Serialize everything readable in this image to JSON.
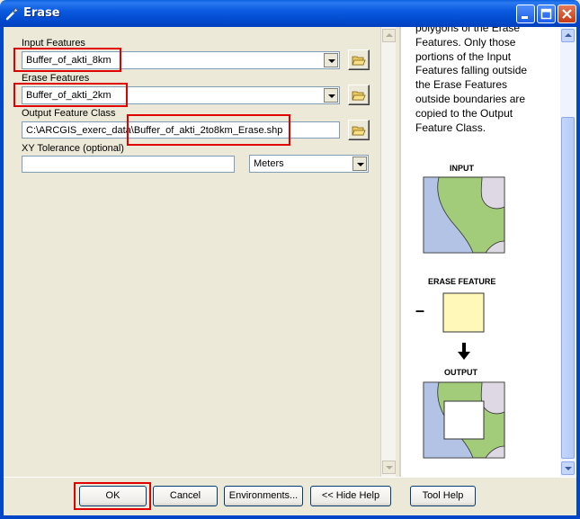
{
  "window": {
    "title": "Erase"
  },
  "form": {
    "input_features": {
      "label": "Input Features",
      "value": "Buffer_of_akti_8km"
    },
    "erase_features": {
      "label": "Erase Features",
      "value": "Buffer_of_akti_2km"
    },
    "output_feature_class": {
      "label": "Output Feature Class",
      "value_prefix": "C:\\ARCGIS_exerc_data",
      "value_suffix": "\\Buffer_of_akti_2to8km_Erase.shp"
    },
    "xy_tolerance": {
      "label": "XY Tolerance (optional)",
      "value": "",
      "units": "Meters"
    }
  },
  "help": {
    "text_lines": [
      "polygons of the Erase",
      "Features. Only those",
      "portions of the Input",
      "Features falling outside",
      "the Erase Features",
      "outside boundaries are",
      "copied to the Output",
      "Feature Class."
    ],
    "diagram": {
      "input_label": "INPUT",
      "erase_label": "ERASE FEATURE",
      "minus_sign": "–",
      "output_label": "OUTPUT"
    }
  },
  "buttons": {
    "ok": "OK",
    "cancel": "Cancel",
    "environments": "Environments...",
    "hide_help": "<< Hide Help",
    "tool_help": "Tool Help"
  },
  "colors": {
    "titlebar": "#0a5ae0",
    "highlight": "#e00000",
    "map_green": "#a3cc7a",
    "map_blue": "#b3c3e6",
    "map_purple": "#ddd8e3",
    "erase_yellow": "#fff8b8"
  },
  "icons": {
    "title": "wrench-icon",
    "browse": "open-folder-icon",
    "arrow": "down-arrow-icon"
  }
}
